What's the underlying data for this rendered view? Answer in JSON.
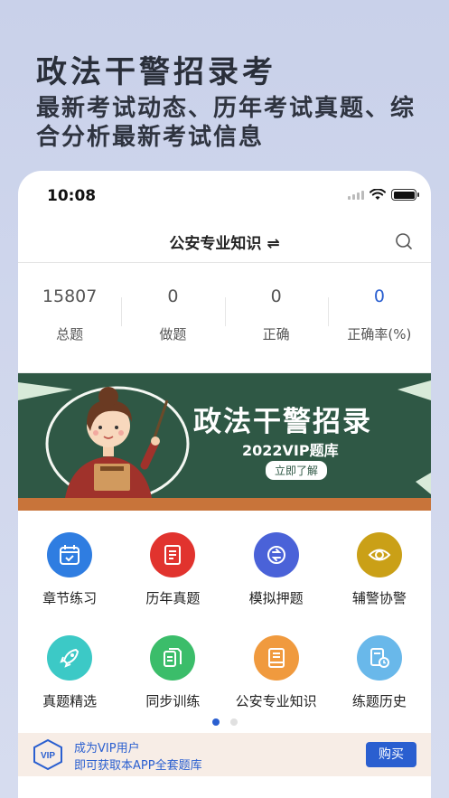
{
  "hero": {
    "title": "政法干警招录考",
    "subtitle": "最新考试动态、历年考试真题、综合分析最新考试信息"
  },
  "status_bar": {
    "time": "10:08"
  },
  "navbar": {
    "title": "公安专业知识 ⇌",
    "search_icon": "search-icon"
  },
  "stats": [
    {
      "value": "15807",
      "label": "总题"
    },
    {
      "value": "0",
      "label": "做题"
    },
    {
      "value": "0",
      "label": "正确"
    },
    {
      "value": "0",
      "label": "正确率(%)"
    }
  ],
  "banner": {
    "title": "政法干警招录",
    "subtitle": "2022VIP题库",
    "button": "立即了解"
  },
  "grid": [
    {
      "label": "章节练习",
      "icon": "calendar-icon",
      "color": "#2f7de1"
    },
    {
      "label": "历年真题",
      "icon": "document-icon",
      "color": "#e1332e"
    },
    {
      "label": "模拟押题",
      "icon": "shuffle-icon",
      "color": "#4a62d8"
    },
    {
      "label": "辅警协警",
      "icon": "eye-icon",
      "color": "#caa017"
    },
    {
      "label": "真题精选",
      "icon": "rocket-icon",
      "color": "#3cc9c6"
    },
    {
      "label": "同步训练",
      "icon": "files-icon",
      "color": "#3bbd6a"
    },
    {
      "label": "公安专业知识",
      "icon": "book-icon",
      "color": "#f09a3e"
    },
    {
      "label": "练题历史",
      "icon": "history-icon",
      "color": "#69b8ea"
    }
  ],
  "pagination": {
    "active_index": 0,
    "count": 2
  },
  "vip_bar": {
    "line1": "成为VIP用户",
    "line2": "即可获取本APP全套题库",
    "badge": "VIP",
    "button": "购买"
  },
  "colors": {
    "accent": "#2a5fd0",
    "banner_green": "#2f5845"
  }
}
